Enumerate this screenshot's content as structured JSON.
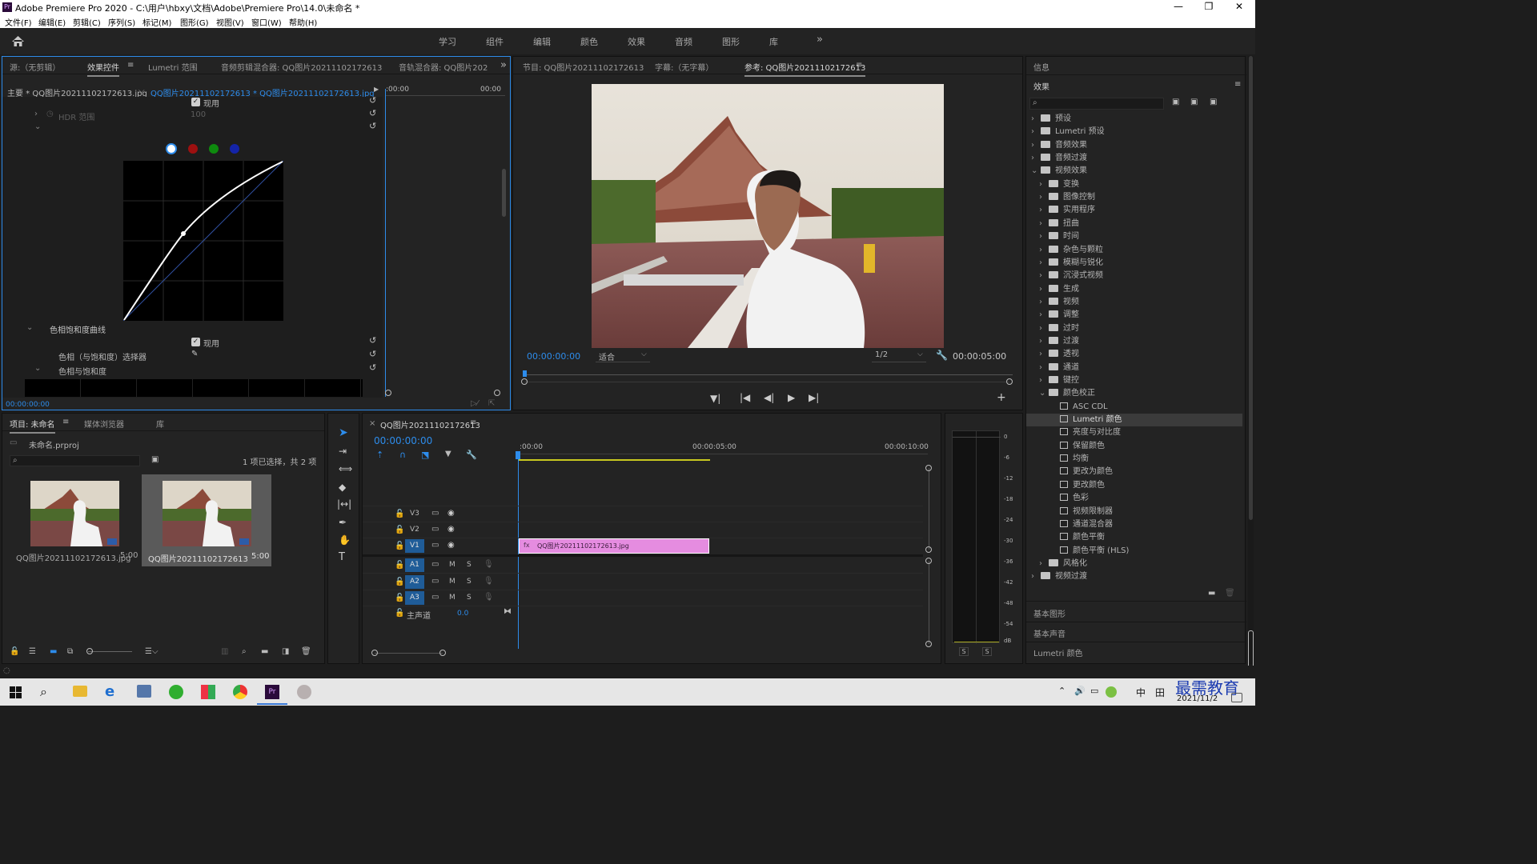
{
  "window": {
    "title": "Adobe Premiere Pro 2020 - C:\\用户\\hbxy\\文档\\Adobe\\Premiere Pro\\14.0\\未命名 *",
    "logo": "Pr"
  },
  "menu": [
    "文件(F)",
    "编辑(E)",
    "剪辑(C)",
    "序列(S)",
    "标记(M)",
    "图形(G)",
    "视图(V)",
    "窗口(W)",
    "帮助(H)"
  ],
  "workspaces": [
    "学习",
    "组件",
    "编辑",
    "颜色",
    "效果",
    "音频",
    "图形",
    "库"
  ],
  "source_panel": {
    "tabs": [
      "源:（无剪辑）",
      "效果控件",
      "Lumetri 范围",
      "音频剪辑混合器: QQ图片20211102172613",
      "音轨混合器: QQ图片202"
    ],
    "master_clip": "主要 * QQ图片20211102172613.jpg",
    "sequence_clip": "QQ图片20211102172613 * QQ图片20211102172613.jpg",
    "timecode_start": ":00:00",
    "timecode_end": "00:00",
    "enable_label": "现用",
    "hdr_label": "HDR 范围",
    "hdr_value": "100",
    "hue_sat_curve": "色相饱和度曲线",
    "enable_label2": "现用",
    "hue_selector": "色相（与饱和度）选择器",
    "hue_vs_sat": "色相与饱和度",
    "footer_time": "00:00:00:00"
  },
  "program_panel": {
    "tabs": [
      "节目: QQ图片20211102172613",
      "字幕:（无字幕）",
      "参考: QQ图片20211102172613"
    ],
    "timecode": "00:00:00:00",
    "fit": "适合",
    "resolution": "1/2",
    "duration": "00:00:05:00"
  },
  "right_panel": {
    "info": "信息",
    "effects_title": "效果",
    "tree": [
      {
        "label": "预设",
        "level": 0,
        "open": false
      },
      {
        "label": "Lumetri 预设",
        "level": 0,
        "open": false
      },
      {
        "label": "音频效果",
        "level": 0,
        "open": false
      },
      {
        "label": "音频过渡",
        "level": 0,
        "open": false
      },
      {
        "label": "视频效果",
        "level": 0,
        "open": true
      },
      {
        "label": "变换",
        "level": 1,
        "open": false
      },
      {
        "label": "图像控制",
        "level": 1,
        "open": false
      },
      {
        "label": "实用程序",
        "level": 1,
        "open": false
      },
      {
        "label": "扭曲",
        "level": 1,
        "open": false
      },
      {
        "label": "时间",
        "level": 1,
        "open": false
      },
      {
        "label": "杂色与颗粒",
        "level": 1,
        "open": false
      },
      {
        "label": "模糊与锐化",
        "level": 1,
        "open": false
      },
      {
        "label": "沉浸式视频",
        "level": 1,
        "open": false
      },
      {
        "label": "生成",
        "level": 1,
        "open": false
      },
      {
        "label": "视频",
        "level": 1,
        "open": false
      },
      {
        "label": "调整",
        "level": 1,
        "open": false
      },
      {
        "label": "过时",
        "level": 1,
        "open": false
      },
      {
        "label": "过渡",
        "level": 1,
        "open": false
      },
      {
        "label": "透视",
        "level": 1,
        "open": false
      },
      {
        "label": "通道",
        "level": 1,
        "open": false
      },
      {
        "label": "键控",
        "level": 1,
        "open": false
      },
      {
        "label": "颜色校正",
        "level": 1,
        "open": true
      },
      {
        "label": "ASC CDL",
        "level": 2,
        "fx": true
      },
      {
        "label": "Lumetri 颜色",
        "level": 2,
        "fx": true,
        "selected": true
      },
      {
        "label": "亮度与对比度",
        "level": 2,
        "fx": true
      },
      {
        "label": "保留颜色",
        "level": 2,
        "fx": true
      },
      {
        "label": "均衡",
        "level": 2,
        "fx": true
      },
      {
        "label": "更改为颜色",
        "level": 2,
        "fx": true
      },
      {
        "label": "更改颜色",
        "level": 2,
        "fx": true
      },
      {
        "label": "色彩",
        "level": 2,
        "fx": true
      },
      {
        "label": "视频限制器",
        "level": 2,
        "fx": true
      },
      {
        "label": "通道混合器",
        "level": 2,
        "fx": true
      },
      {
        "label": "颜色平衡",
        "level": 2,
        "fx": true
      },
      {
        "label": "颜色平衡 (HLS)",
        "level": 2,
        "fx": true
      },
      {
        "label": "风格化",
        "level": 1,
        "open": false
      },
      {
        "label": "视频过渡",
        "level": 0,
        "open": false
      }
    ],
    "basic_graphics": "基本图形",
    "basic_sound": "基本声音",
    "lumetri_color": "Lumetri 颜色"
  },
  "project_panel": {
    "tabs": [
      "项目: 未命名",
      "媒体浏览器",
      "库"
    ],
    "project_file": "未命名.prproj",
    "selection": "1 项已选择，共 2 项",
    "items": [
      {
        "name": "QQ图片20211102172613.jpg",
        "duration": "5:00"
      },
      {
        "name": "QQ图片20211102172613",
        "duration": "5:00"
      }
    ]
  },
  "timeline": {
    "sequence": "QQ图片20211102172613",
    "timecode": "00:00:00:00",
    "ruler": [
      ":00:00",
      "00:00:05:00",
      "00:00:10:00"
    ],
    "video_tracks": [
      "V3",
      "V2",
      "V1"
    ],
    "audio_tracks": [
      "A1",
      "A2",
      "A3"
    ],
    "master_label": "主声道",
    "master_value": "0.0",
    "clip_name": "QQ图片20211102172613.jpg",
    "m": "M",
    "s": "S"
  },
  "meter": {
    "scale": [
      "0",
      "-6",
      "-12",
      "-18",
      "-24",
      "-30",
      "-36",
      "-42",
      "-48",
      "-54",
      "dB"
    ],
    "solo_left": "S",
    "solo_right": "S"
  },
  "taskbar": {
    "ime": "中",
    "grid": "田",
    "date": "2021/11/2",
    "watermark": "最需教育"
  }
}
